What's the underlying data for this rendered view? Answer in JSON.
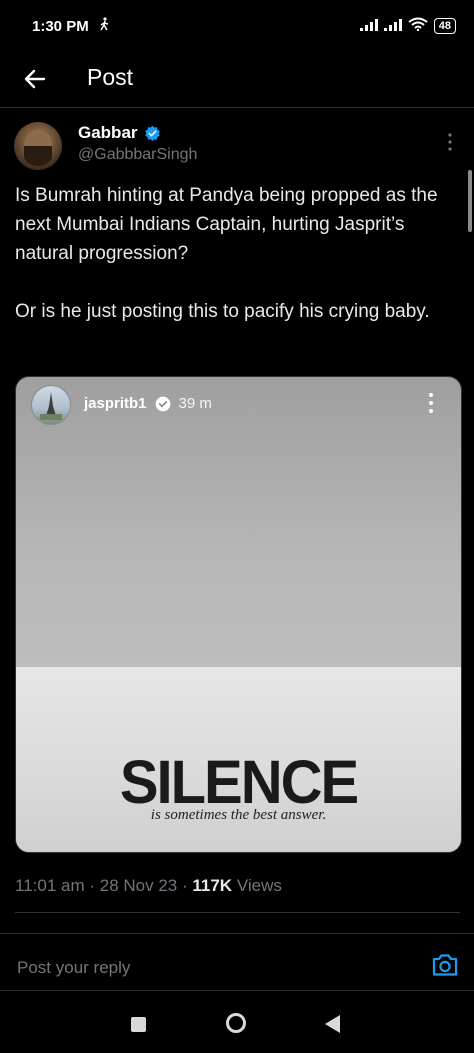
{
  "status_bar": {
    "time": "1:30 PM",
    "battery": "48"
  },
  "header": {
    "title": "Post"
  },
  "author": {
    "name": "Gabbar",
    "handle": "@GabbbarSingh",
    "verified": true
  },
  "tweet": {
    "text": "Is Bumrah hinting at Pandya being propped as the next Mumbai Indians Captain, hurting Jasprit’s natural progression?\n\nOr is he just posting this to pacify his crying baby."
  },
  "media": {
    "poster_name": "jaspritb1",
    "time_ago": "39 m",
    "headline": "SILENCE",
    "subline": "is sometimes the best answer."
  },
  "meta": {
    "time": "11:01 am",
    "date": "28 Nov 23",
    "views_count": "117K",
    "views_label": "Views"
  },
  "reply": {
    "placeholder": "Post your reply"
  },
  "colors": {
    "background": "#000000",
    "text_primary": "#e7e9ea",
    "text_secondary": "#71767b",
    "accent": "#1d9bf0",
    "divider": "#2f3336"
  },
  "icons": {
    "back": "arrow-left-icon",
    "more": "more-vertical-icon",
    "verified": "verified-badge-icon",
    "camera": "camera-icon",
    "walk": "walking-icon",
    "signal": "signal-icon",
    "wifi": "wifi-icon"
  }
}
